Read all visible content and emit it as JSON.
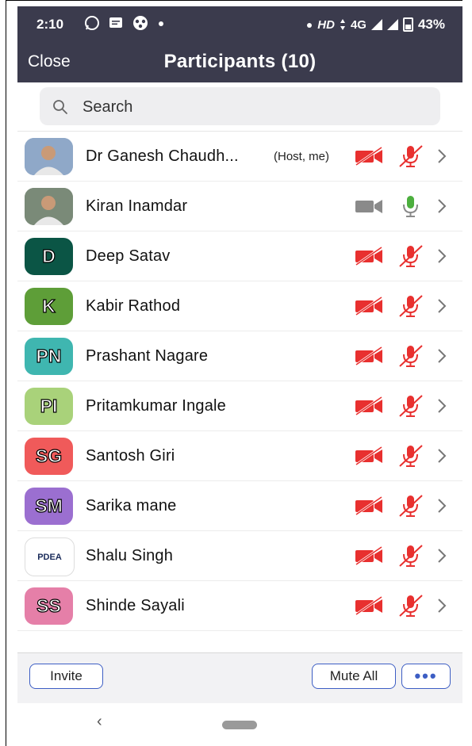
{
  "status_bar": {
    "time": "2:10",
    "hd": "HD",
    "network": "4G",
    "battery": "43%",
    "app_icons": [
      "whatsapp-icon",
      "message-icon",
      "app-icon",
      "dot-icon"
    ]
  },
  "header": {
    "close_label": "Close",
    "title": "Participants (10)"
  },
  "search": {
    "placeholder": "Search"
  },
  "participants": [
    {
      "name": "Dr Ganesh Chaudh...",
      "role": "(Host, me)",
      "avatar_text": "",
      "avatar_type": "photo",
      "avatar_color": "#8fa8c8",
      "video_on": false,
      "audio_on": false
    },
    {
      "name": "Kiran Inamdar",
      "role": "",
      "avatar_text": "",
      "avatar_type": "photo",
      "avatar_color": "#7a8a78",
      "video_on": true,
      "audio_on": true
    },
    {
      "name": "Deep Satav",
      "role": "",
      "avatar_text": "D",
      "avatar_type": "initials",
      "avatar_color": "#0b5545",
      "video_on": false,
      "audio_on": false
    },
    {
      "name": "Kabir Rathod",
      "role": "",
      "avatar_text": "K",
      "avatar_type": "initials",
      "avatar_color": "#5e9e38",
      "video_on": false,
      "audio_on": false
    },
    {
      "name": "Prashant Nagare",
      "role": "",
      "avatar_text": "PN",
      "avatar_type": "initials",
      "avatar_color": "#3fb6b0",
      "video_on": false,
      "audio_on": false
    },
    {
      "name": "Pritamkumar Ingale",
      "role": "",
      "avatar_text": "PI",
      "avatar_type": "initials",
      "avatar_color": "#a9d27a",
      "video_on": false,
      "audio_on": false
    },
    {
      "name": "Santosh Giri",
      "role": "",
      "avatar_text": "SG",
      "avatar_type": "initials",
      "avatar_color": "#f05a5a",
      "video_on": false,
      "audio_on": false
    },
    {
      "name": "Sarika mane",
      "role": "",
      "avatar_text": "SM",
      "avatar_type": "initials",
      "avatar_color": "#9b6fd0",
      "video_on": false,
      "audio_on": false
    },
    {
      "name": "Shalu Singh",
      "role": "",
      "avatar_text": "PDEA",
      "avatar_type": "logo",
      "avatar_color": "#ffffff",
      "video_on": false,
      "audio_on": false
    },
    {
      "name": "Shinde Sayali",
      "role": "",
      "avatar_text": "SS",
      "avatar_type": "initials",
      "avatar_color": "#e57fa8",
      "video_on": false,
      "audio_on": false
    }
  ],
  "footer": {
    "invite_label": "Invite",
    "mute_all_label": "Mute All",
    "more_label": "•••"
  },
  "colors": {
    "header_bg": "#3b3b4d",
    "muted_red": "#e8302f",
    "active_green": "#4caf3e",
    "active_gray": "#8a8a8a",
    "button_border": "#3d5ec4"
  }
}
